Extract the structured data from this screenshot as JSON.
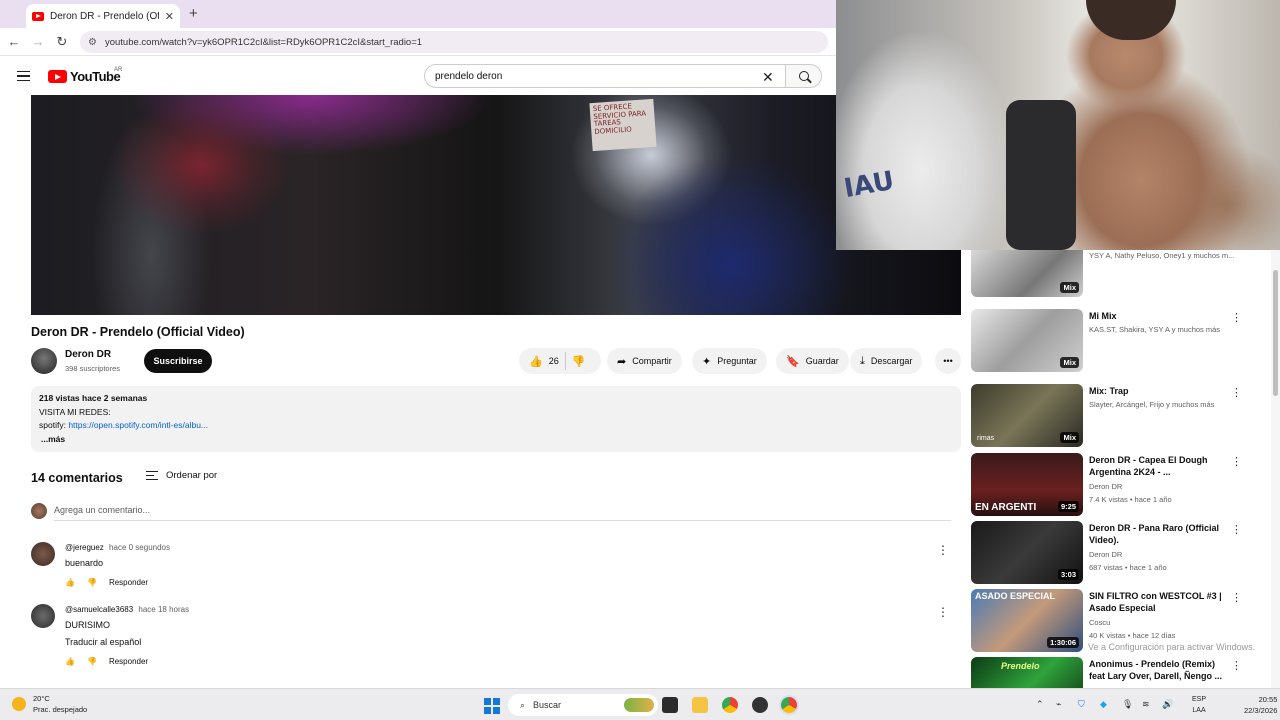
{
  "browser": {
    "tab_title": "Deron DR - Prendelo (Official V",
    "url": "youtube.com/watch?v=yk6OPR1C2cI&list=RDyk6OPR1C2cI&start_radio=1"
  },
  "header": {
    "logo_text": "YouTube",
    "country_code": "AR",
    "search_value": "prendelo deron"
  },
  "video": {
    "sign_text": "SE OFRECE SERVICIO PARA TAREAS DOMICILIO",
    "title": "Deron DR - Prendelo (Official Video)",
    "channel": "Deron DR",
    "subscribers": "398 suscriptores",
    "subscribe_label": "Suscribirse",
    "likes": "26",
    "share_label": "Compartir",
    "ask_label": "Preguntar",
    "save_label": "Guardar",
    "download_label": "Descargar"
  },
  "description": {
    "stats": "218 vistas  hace 2 semanas",
    "line1": "VISITA MI REDES:",
    "spotify_prefix": "spotify:",
    "spotify_link": "https://open.spotify.com/intl-es/albu...",
    "more": "...más"
  },
  "comments": {
    "count": "14 comentarios",
    "sort_label": "Ordenar por",
    "add_placeholder": "Agrega un comentario...",
    "reply_label": "Responder",
    "items": [
      {
        "handle": "@jereguez",
        "time": "hace 0 segundos",
        "text": "buenardo"
      },
      {
        "handle": "@samuelcalle3683",
        "time": "hace 18 horas",
        "text": "DURISIMO",
        "translate": "Traducir al español"
      }
    ]
  },
  "sidebar": {
    "items": [
      {
        "title": "",
        "meta1": "YSY A, Nathy Peluso, Oney1 y muchos m...",
        "badge": "Mix"
      },
      {
        "title": "Mi Mix",
        "meta1": "KAS.ST, Shakira, YSY A y muchos más",
        "badge": "Mix"
      },
      {
        "title": "Mix: Trap",
        "meta1": "Slayter, Arcángel, Frijo y muchos más",
        "badge": "Mix",
        "thumb_text": "rimas"
      },
      {
        "title": "Deron DR - Capea El Dough Argentina 2K24 - ...",
        "meta1": "Deron DR",
        "meta2": "7.4 K vistas • hace 1 año",
        "badge": "9:25",
        "thumb_text": "EN ARGENTI"
      },
      {
        "title": "Deron DR - Pana Raro (Official Video).",
        "meta1": "Deron DR",
        "meta2": "687 vistas • hace 1 año",
        "badge": "3:03"
      },
      {
        "title": "SIN FILTRO con WESTCOL #3 | Asado Especial",
        "meta1": "Coscu",
        "meta2": "40 K vistas • hace 12 días",
        "badge": "1:30:06",
        "thumb_text": "ASADO ESPECIAL"
      },
      {
        "title": "Anonimus - Prendelo (Remix) feat Lary Over, Darell, Ñengo ...",
        "meta1": "",
        "thumb_text": "Prendelo"
      }
    ],
    "watermark": "Ve a Configuración para activar Windows."
  },
  "taskbar": {
    "temperature": "20°C",
    "weather": "Prac. despejado",
    "search_placeholder": "Buscar",
    "lang1": "ESP",
    "lang2": "LAA",
    "time": "20:55",
    "date": "22/3/2026"
  },
  "colors": {
    "youtube_red": "#ff0000",
    "link_blue": "#065fd4",
    "tab_bar": "#e9dff0"
  }
}
